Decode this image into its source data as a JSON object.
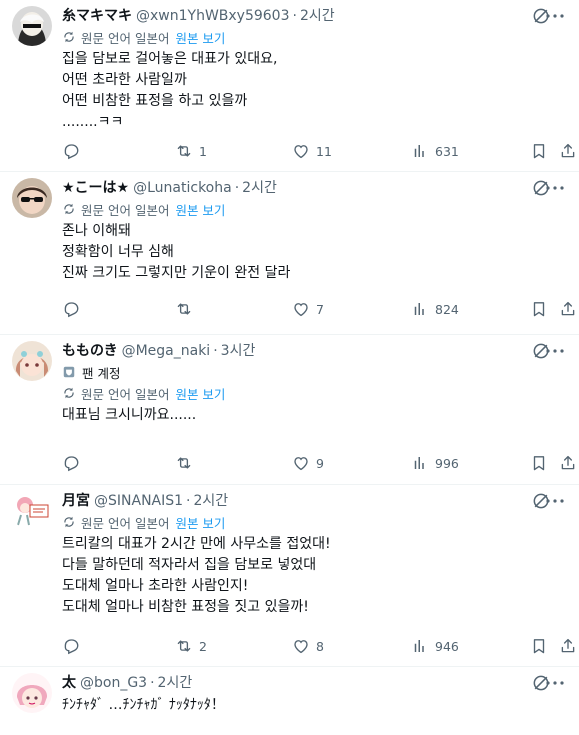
{
  "tweets": [
    {
      "display_name": "糸マキマキ",
      "handle": "@xwn1YhWBxy59603",
      "time": "2시간",
      "translate": {
        "label": "원문 언어 일본어",
        "link": "원본 보기"
      },
      "lines": [
        "집을 담보로 걸어놓은 대표가 있대요,",
        "어떤 초라한 사람일까",
        "어떤 비참한 표정을 하고 있을까",
        "........ㅋㅋ"
      ],
      "reply_count": "",
      "repost_count": "1",
      "like_count": "11",
      "view_count": "631",
      "avatar": "avatar-white-hair"
    },
    {
      "display_name": "★こーは★",
      "handle": "@Lunatickoha",
      "time": "2시간",
      "translate": {
        "label": "원문 언어 일본어",
        "link": "원본 보기"
      },
      "lines": [
        "존나 이해돼",
        "정확함이 너무 심해",
        "진짜 크기도 그렇지만 기운이 완전 달라"
      ],
      "reply_count": "",
      "repost_count": "",
      "like_count": "7",
      "view_count": "824",
      "avatar": "avatar-sunglasses"
    },
    {
      "display_name": "もものき",
      "handle": "@Mega_naki",
      "time": "3시간",
      "badge": "팬 계정",
      "translate": {
        "label": "원문 언어 일본어",
        "link": "원본 보기"
      },
      "lines": [
        "대표님 크시니까요......"
      ],
      "reply_count": "",
      "repost_count": "",
      "like_count": "9",
      "view_count": "996",
      "avatar": "avatar-pink-hair"
    },
    {
      "display_name": "月宮",
      "handle": "@SINANAIS1",
      "time": "2시간",
      "translate": {
        "label": "원문 언어 일본어",
        "link": "원본 보기"
      },
      "lines": [
        "트리칼의 대표가 2시간 만에 사무소를 접었대!",
        "다들 말하던데 적자라서 집을 담보로 넣었대",
        "도대체 얼마나 초라한 사람인지!",
        "도대체 얼마나 비참한 표정을 짓고 있을까!"
      ],
      "reply_count": "",
      "repost_count": "2",
      "like_count": "8",
      "view_count": "946",
      "avatar": "avatar-sign-character"
    },
    {
      "display_name": "太",
      "handle": "@bon_G3",
      "time": "2시간",
      "lines": [
        "ﾁﾝﾁｬﾀﾞ …ﾁﾝﾁｬｶﾞ ﾅｯﾀﾅｯﾀ！"
      ],
      "avatar": "avatar-pink-character"
    }
  ],
  "colors": {
    "text": "#0f1419",
    "muted": "#536471",
    "link": "#1d9bf0",
    "divider": "#eff3f4"
  }
}
